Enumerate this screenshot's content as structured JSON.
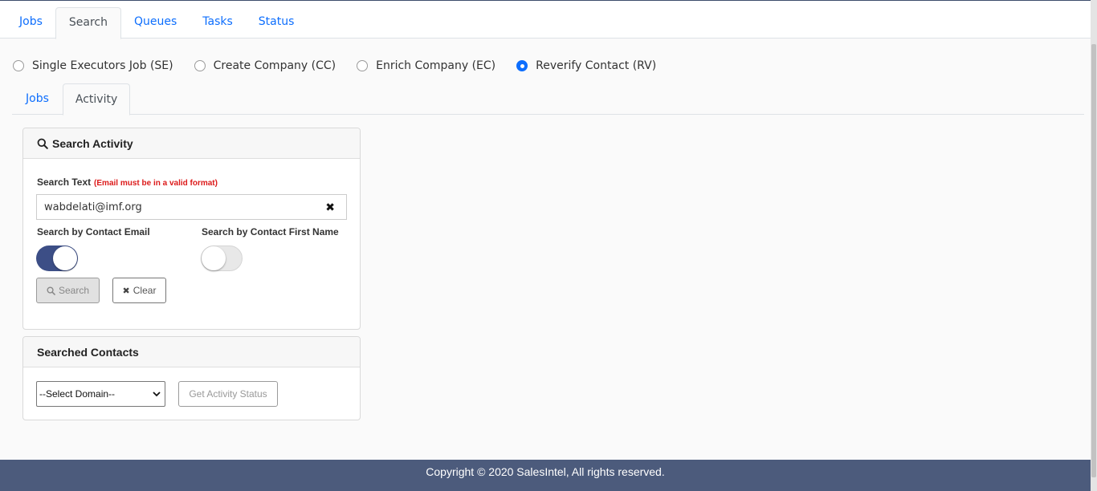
{
  "main_nav": {
    "tabs": [
      {
        "label": "Jobs"
      },
      {
        "label": "Search"
      },
      {
        "label": "Queues"
      },
      {
        "label": "Tasks"
      },
      {
        "label": "Status"
      }
    ],
    "active": "Search"
  },
  "job_types": [
    {
      "label": "Single Executors Job (SE)",
      "checked": false
    },
    {
      "label": "Create Company (CC)",
      "checked": false
    },
    {
      "label": "Enrich Company (EC)",
      "checked": false
    },
    {
      "label": "Reverify Contact (RV)",
      "checked": true
    }
  ],
  "sub_nav": {
    "tabs": [
      {
        "label": "Jobs"
      },
      {
        "label": "Activity"
      }
    ],
    "active": "Activity"
  },
  "search_activity": {
    "title": "Search Activity",
    "search_text_label": "Search Text",
    "search_text_hint": "(Email must be in a valid format)",
    "search_value": "wabdelati@imf.org",
    "toggle_email_label": "Search by Contact Email",
    "toggle_email_on": true,
    "toggle_first_name_label": "Search by Contact First Name",
    "toggle_first_name_on": false,
    "search_button": "Search",
    "clear_button": "Clear"
  },
  "searched_contacts": {
    "title": "Searched Contacts",
    "domain_select": "--Select Domain--",
    "get_status_button": "Get Activity Status"
  },
  "footer": {
    "text": "Copyright © 2020 SalesIntel, All rights reserved."
  },
  "colors": {
    "link_blue": "#0d6efd",
    "toggle_on": "#3c4e86",
    "footer_bg": "#4c5b7c",
    "hint_red": "#dc1a1a"
  }
}
